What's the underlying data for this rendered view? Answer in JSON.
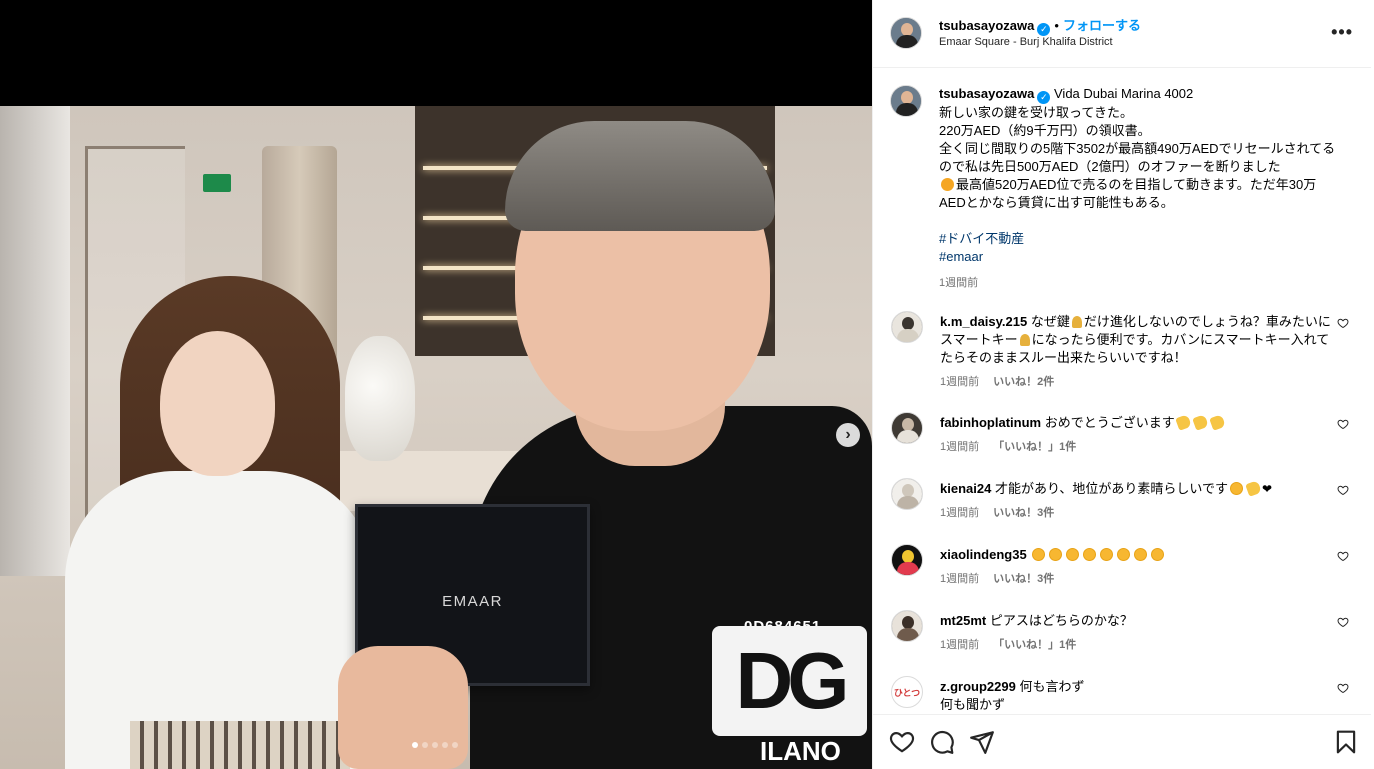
{
  "post": {
    "username": "tsubasayozawa",
    "follow_label": "フォローする",
    "separator": "•",
    "location": "Emaar Square - Burj Khalifa District"
  },
  "media": {
    "box_label": "EMAAR",
    "shirt_code": "0D684651",
    "shirt_logo": "DG",
    "shirt_text": "ILANO",
    "next_icon": "chevron-right-icon",
    "carousel_count": 5,
    "carousel_active": 1
  },
  "caption": {
    "username": "tsubasayozawa",
    "title": "Vida Dubai Marina 4002",
    "lines": "新しい家の鍵を受け取ってきた。\n220万AED（約9千万円）の領収書。\n全く同じ間取りの5階下3502が最高額490万AEDでリセールされてるので私は先日500万AED（2億円）のオファーを断りました",
    "after_emoji": "最高値520万AED位で売るのを目指して動きます。ただ年30万AEDとかなら賃貸に出す可能性もある。",
    "hashtag1": "#ドバイ不動産",
    "hashtag2": "#emaar",
    "time": "1週間前"
  },
  "comments": [
    {
      "username": "k.m_daisy.215",
      "text_a": "なぜ鍵",
      "text_b": "だけ進化しないのでしょうね？車みたいにスマートキー",
      "text_c": "になったら便利です。カバンにスマートキー入れてたらそのままスルー出来たらいいですね！",
      "time": "1週間前",
      "likes": "いいね！2件"
    },
    {
      "username": "fabinhoplatinum",
      "text": "おめでとうございます",
      "time": "1週間前",
      "likes": "「いいね！」1件"
    },
    {
      "username": "kienai24",
      "text": "才能があり、地位があり素晴らしいです",
      "time": "1週間前",
      "likes": "いいね！3件"
    },
    {
      "username": "xiaolindeng35",
      "text": "",
      "time": "1週間前",
      "likes": "いいね！3件"
    },
    {
      "username": "mt25mt",
      "text": "ピアスはどちらのかな？",
      "time": "1週間前",
      "likes": "「いいね！」1件"
    },
    {
      "username": "z.group2299",
      "text": "何も言わず",
      "text2": "何も聞かず",
      "avatar_text": "ひとつ"
    }
  ],
  "colors": {
    "accent": "#0095f6",
    "hashtag": "#00376b",
    "muted": "#737373",
    "verified": "#0095f6"
  },
  "actions": {
    "like_icon": "heart-icon",
    "comment_icon": "comment-icon",
    "share_icon": "share-icon",
    "save_icon": "bookmark-icon",
    "more_icon": "more-options-icon"
  }
}
